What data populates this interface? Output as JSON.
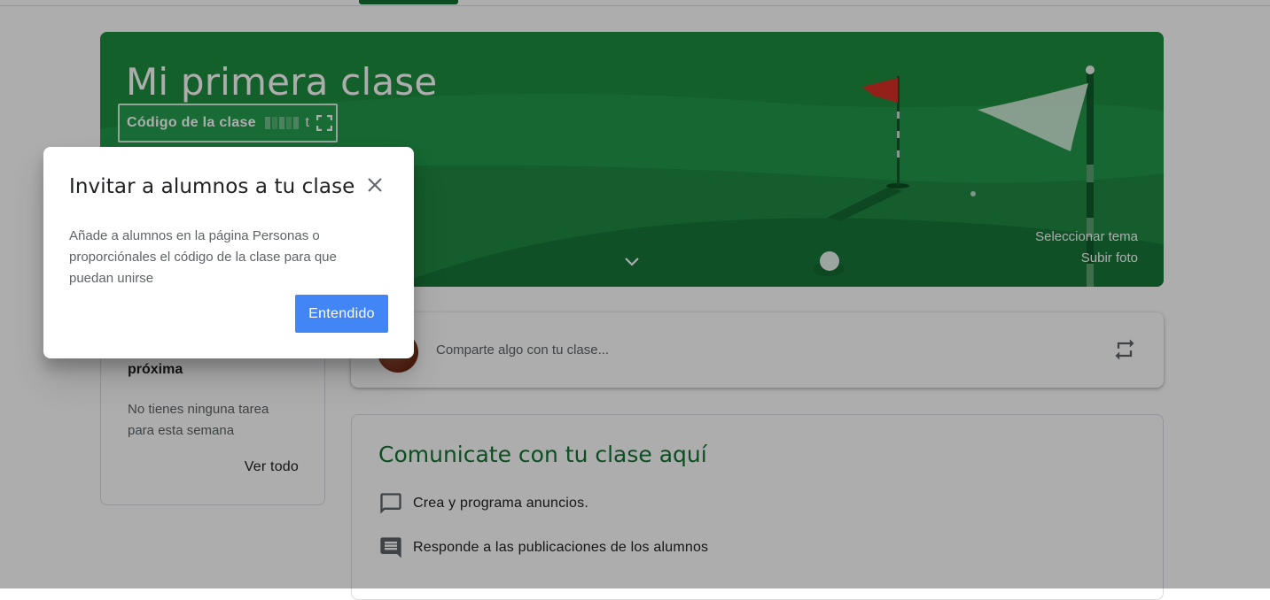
{
  "banner": {
    "title": "Mi primera clase",
    "code_label": "Código de la clase",
    "code_value_tail": "t",
    "select_theme": "Seleccionar tema",
    "upload_photo": "Subir foto"
  },
  "upcoming": {
    "title": "próxima",
    "empty_text": "No tienes ninguna tarea para esta semana",
    "view_all": "Ver todo"
  },
  "share": {
    "placeholder": "Comparte algo con tu clase..."
  },
  "communicate": {
    "title": "Comunicate con tu clase aquí",
    "items": [
      {
        "label": "Crea y programa anuncios.",
        "icon": "announcement-icon"
      },
      {
        "label": "Responde a las publicaciones de los alumnos",
        "icon": "comment-icon"
      }
    ]
  },
  "dialog": {
    "title": "Invitar a alumnos a tu clase",
    "body": "Añade a alumnos en la página Personas o proporciónales el código de la clase para que puedan unirse",
    "confirm": "Entendido"
  },
  "colors": {
    "banner_green": "#1e8e3e",
    "title_green": "#137333",
    "button_blue": "#4285f4",
    "flag_red": "#d93025"
  }
}
